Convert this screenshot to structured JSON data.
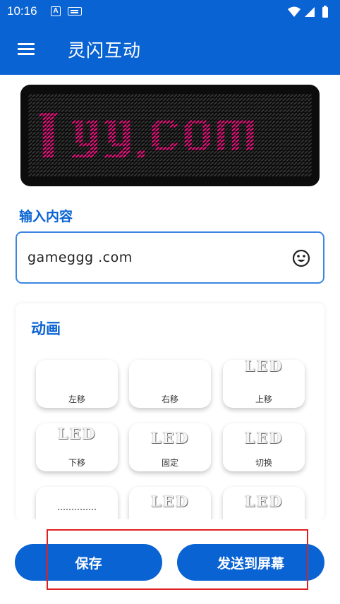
{
  "status": {
    "time": "10:16",
    "a_badge": "A"
  },
  "appbar": {
    "title": "灵闪互动"
  },
  "led": {
    "text": "lyy.com",
    "dot_color": "#e0157a",
    "bg_color": "#0c0c0c"
  },
  "input": {
    "label": "输入内容",
    "value": "gameggg .com"
  },
  "animations": {
    "title": "动画",
    "items": [
      {
        "label": "左移",
        "preview": ""
      },
      {
        "label": "右移",
        "preview": ""
      },
      {
        "label": "上移",
        "preview": "LED"
      },
      {
        "label": "下移",
        "preview": "LED"
      },
      {
        "label": "固定",
        "preview": "LED"
      },
      {
        "label": "切换",
        "preview": "LED"
      },
      {
        "label": "",
        "preview": ""
      },
      {
        "label": "",
        "preview": "LED"
      },
      {
        "label": "",
        "preview": "LED"
      }
    ]
  },
  "buttons": {
    "save": "保存",
    "send": "发送到屏幕"
  },
  "colors": {
    "primary": "#0a63d3",
    "annotation": "#e02020"
  }
}
